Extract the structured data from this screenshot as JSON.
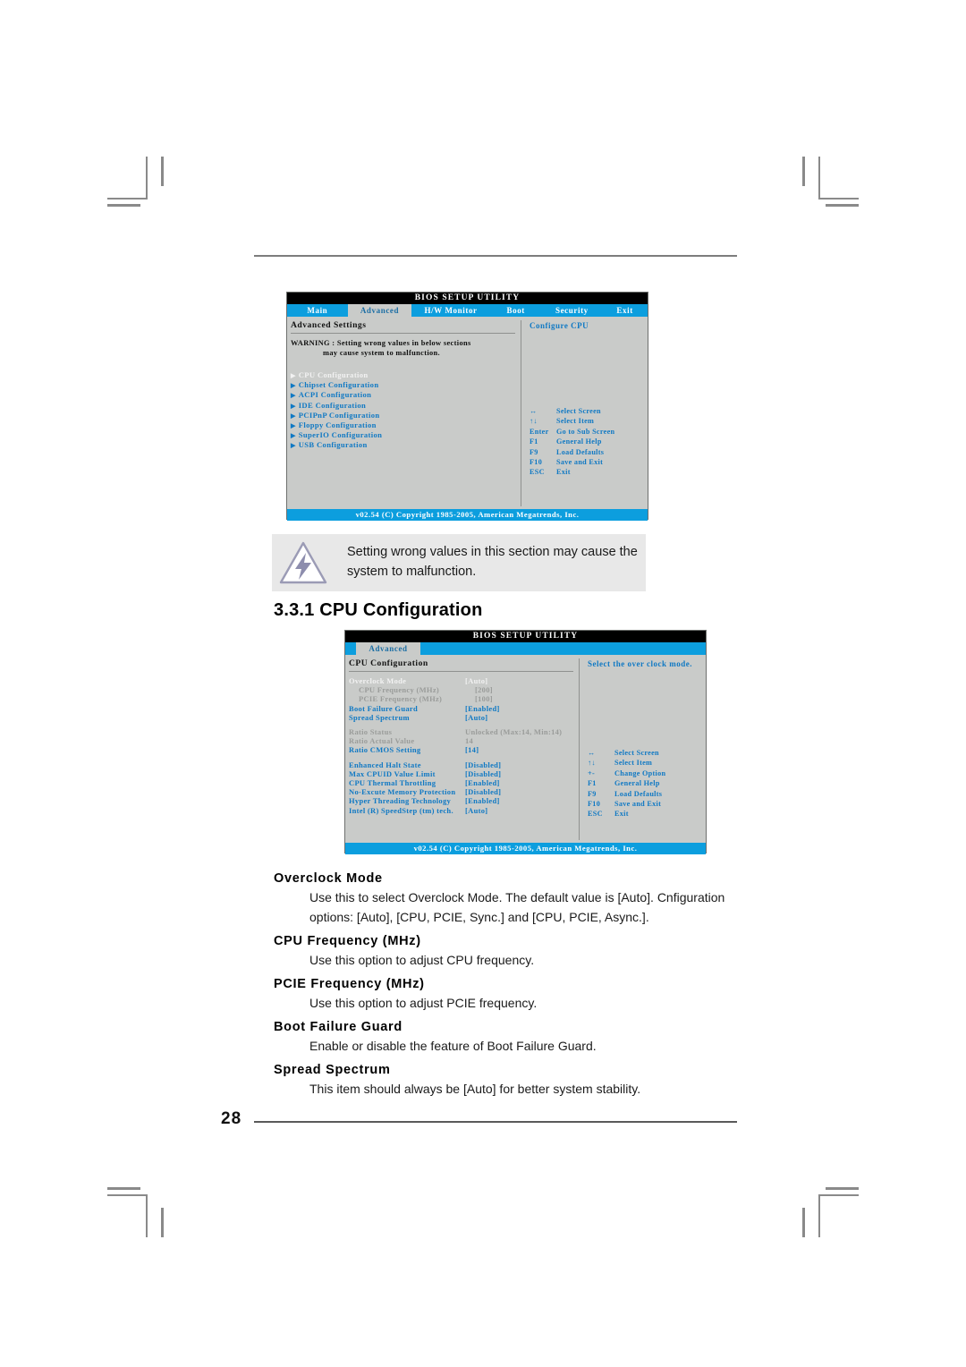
{
  "page": {
    "number": "28"
  },
  "bios_screen_1": {
    "title": "BIOS SETUP UTILITY",
    "tabs": [
      {
        "label": "Main",
        "active": false
      },
      {
        "label": "Advanced",
        "active": true
      },
      {
        "label": "H/W Monitor",
        "active": false
      },
      {
        "label": "Boot",
        "active": false
      },
      {
        "label": "Security",
        "active": false
      },
      {
        "label": "Exit",
        "active": false
      }
    ],
    "section_title": "Advanced Settings",
    "warning_line1": "WARNING : Setting wrong values in below sections",
    "warning_line2": "may cause system to malfunction.",
    "menu_items": [
      {
        "label": "CPU Configuration",
        "selected": true
      },
      {
        "label": "Chipset Configuration",
        "selected": false
      },
      {
        "label": "ACPI Configuration",
        "selected": false
      },
      {
        "label": "IDE Configuration",
        "selected": false
      },
      {
        "label": "PCIPnP Configuration",
        "selected": false
      },
      {
        "label": "Floppy Configuration",
        "selected": false
      },
      {
        "label": "SuperIO Configuration",
        "selected": false
      },
      {
        "label": "USB Configuration",
        "selected": false
      }
    ],
    "help_title": "Configure CPU",
    "keys": [
      {
        "key": "↔",
        "desc": "Select Screen"
      },
      {
        "key": "↑↓",
        "desc": "Select Item"
      },
      {
        "key": "Enter",
        "desc": "Go to Sub Screen"
      },
      {
        "key": "F1",
        "desc": "General Help"
      },
      {
        "key": "F9",
        "desc": "Load Defaults"
      },
      {
        "key": "F10",
        "desc": "Save and Exit"
      },
      {
        "key": "ESC",
        "desc": "Exit"
      }
    ],
    "footer": "v02.54 (C) Copyright 1985-2005, American Megatrends, Inc."
  },
  "callout": {
    "icon": "warning-triangle-lightning-icon",
    "text": "Setting wrong values in this section may cause the system to malfunction."
  },
  "heading": "3.3.1 CPU Configuration",
  "bios_screen_2": {
    "title": "BIOS SETUP UTILITY",
    "tabs": [
      {
        "label": "Advanced",
        "active": true
      }
    ],
    "section_title": "CPU Configuration",
    "help_title": "Select the over clock mode.",
    "settings_group_1": [
      {
        "label": "Overclock Mode",
        "value": "[Auto]",
        "state": "selected",
        "sub": false
      },
      {
        "label": "CPU Frequency (MHz)",
        "value": "[200]",
        "state": "dim",
        "sub": true
      },
      {
        "label": "PCIE Frequency (MHz)",
        "value": "[100]",
        "state": "dim",
        "sub": true
      },
      {
        "label": "Boot Failure Guard",
        "value": "[Enabled]",
        "state": "normal",
        "sub": false
      },
      {
        "label": "Spread Spectrum",
        "value": "[Auto]",
        "state": "normal",
        "sub": false
      }
    ],
    "settings_group_2": [
      {
        "label": "Ratio Status",
        "value": "Unlocked (Max:14, Min:14)",
        "state": "plain",
        "sub": false
      },
      {
        "label": "Ratio Actual Value",
        "value": "14",
        "state": "plain",
        "sub": false
      },
      {
        "label": "Ratio CMOS Setting",
        "value": "[14]",
        "state": "normal",
        "sub": false
      }
    ],
    "settings_group_3": [
      {
        "label": "Enhanced Halt State",
        "value": "[Disabled]",
        "state": "normal",
        "sub": false
      },
      {
        "label": "Max CPUID Value Limit",
        "value": "[Disabled]",
        "state": "normal",
        "sub": false
      },
      {
        "label": "CPU Thermal Throttling",
        "value": "[Enabled]",
        "state": "normal",
        "sub": false
      },
      {
        "label": "No-Excute Memory Protection",
        "value": "[Disabled]",
        "state": "normal",
        "sub": false
      },
      {
        "label": "Hyper Threading Technology",
        "value": "[Enabled]",
        "state": "normal",
        "sub": false
      },
      {
        "label": "Intel (R) SpeedStep (tm) tech.",
        "value": "[Auto]",
        "state": "normal",
        "sub": false
      }
    ],
    "keys": [
      {
        "key": "↔",
        "desc": "Select Screen"
      },
      {
        "key": "↑↓",
        "desc": "Select Item"
      },
      {
        "key": "+-",
        "desc": "Change Option"
      },
      {
        "key": "F1",
        "desc": "General Help"
      },
      {
        "key": "F9",
        "desc": "Load Defaults"
      },
      {
        "key": "F10",
        "desc": "Save and Exit"
      },
      {
        "key": "ESC",
        "desc": "Exit"
      }
    ],
    "footer": "v02.54 (C) Copyright 1985-2005, American Megatrends, Inc."
  },
  "descriptions": [
    {
      "term": "Overclock Mode",
      "lines": [
        "Use this to select Overclock Mode. The default value is [Auto]. Cnfiguration",
        "options: [Auto], [CPU, PCIE, Sync.] and [CPU, PCIE, Async.]."
      ]
    },
    {
      "term": "CPU Frequency (MHz)",
      "lines": [
        "Use this option to adjust CPU frequency."
      ]
    },
    {
      "term": "PCIE Frequency (MHz)",
      "lines": [
        "Use this option to adjust PCIE frequency."
      ]
    },
    {
      "term": "Boot Failure Guard",
      "lines": [
        "Enable or disable the feature of Boot Failure Guard."
      ]
    },
    {
      "term": "Spread Spectrum",
      "lines": [
        "This item should always be [Auto] for better system stability."
      ]
    }
  ],
  "colors": {
    "bios_accent": "#0c9ede",
    "bios_text_blue": "#1079c4",
    "bios_panel": "#c9cbc9",
    "titlebar": "#000000"
  }
}
